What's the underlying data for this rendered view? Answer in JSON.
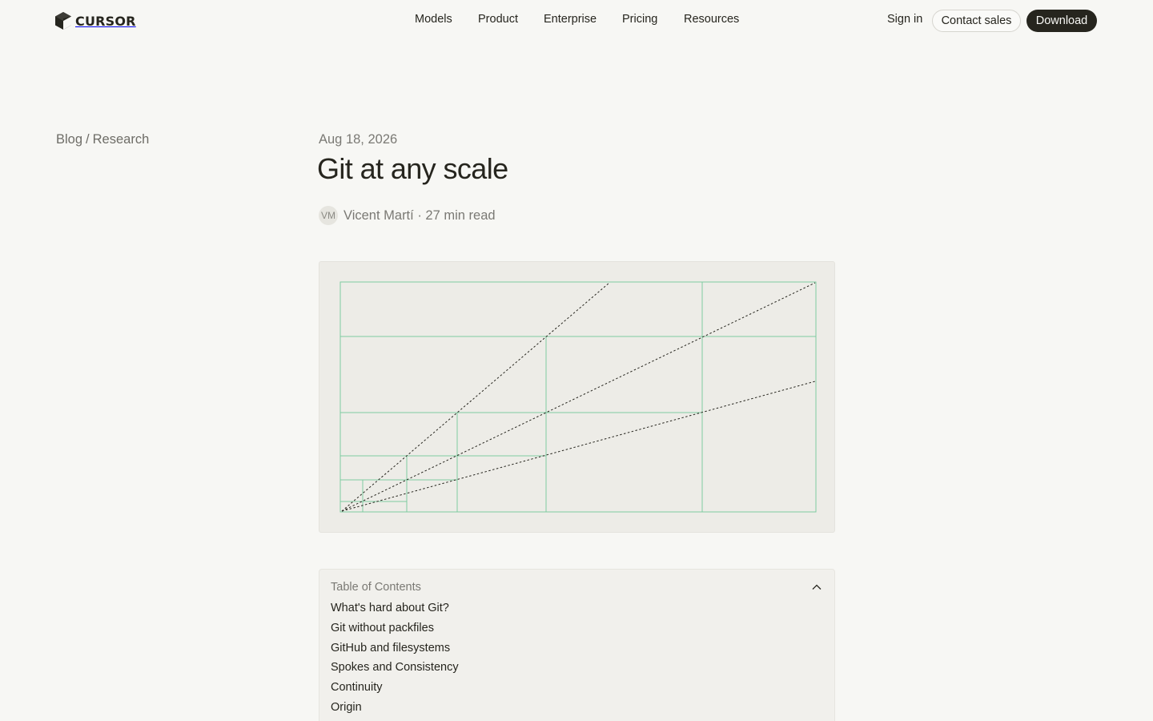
{
  "header": {
    "logo_text": "CURSOR",
    "nav": [
      "Models",
      "Product",
      "Enterprise",
      "Pricing",
      "Resources"
    ],
    "sign_in": "Sign in",
    "contact_sales": "Contact sales",
    "download": "Download"
  },
  "breadcrumb": {
    "blog": "Blog",
    "separator": "/",
    "section": "Research"
  },
  "article": {
    "date": "Aug 18, 2026",
    "title": "Git at any scale",
    "author_initials": "VM",
    "author": "Vicent Martí",
    "byline_separator": "·",
    "read_time": "27 min read"
  },
  "figure": {
    "grid_color": "#7fcba0",
    "dash_color": "#26251e",
    "background": "#edece7"
  },
  "toc": {
    "heading": "Table of Contents",
    "toggle_icon": "chevron-up-icon",
    "items": [
      "What's hard about Git?",
      "Git without packfiles",
      "GitHub and filesystems",
      "Spokes and Consistency",
      "Continuity",
      "Origin"
    ]
  },
  "colors": {
    "page_background": "#f7f7f4",
    "text": "#26251e",
    "muted_text": "#7a7974",
    "button_dark": "#26251e"
  }
}
